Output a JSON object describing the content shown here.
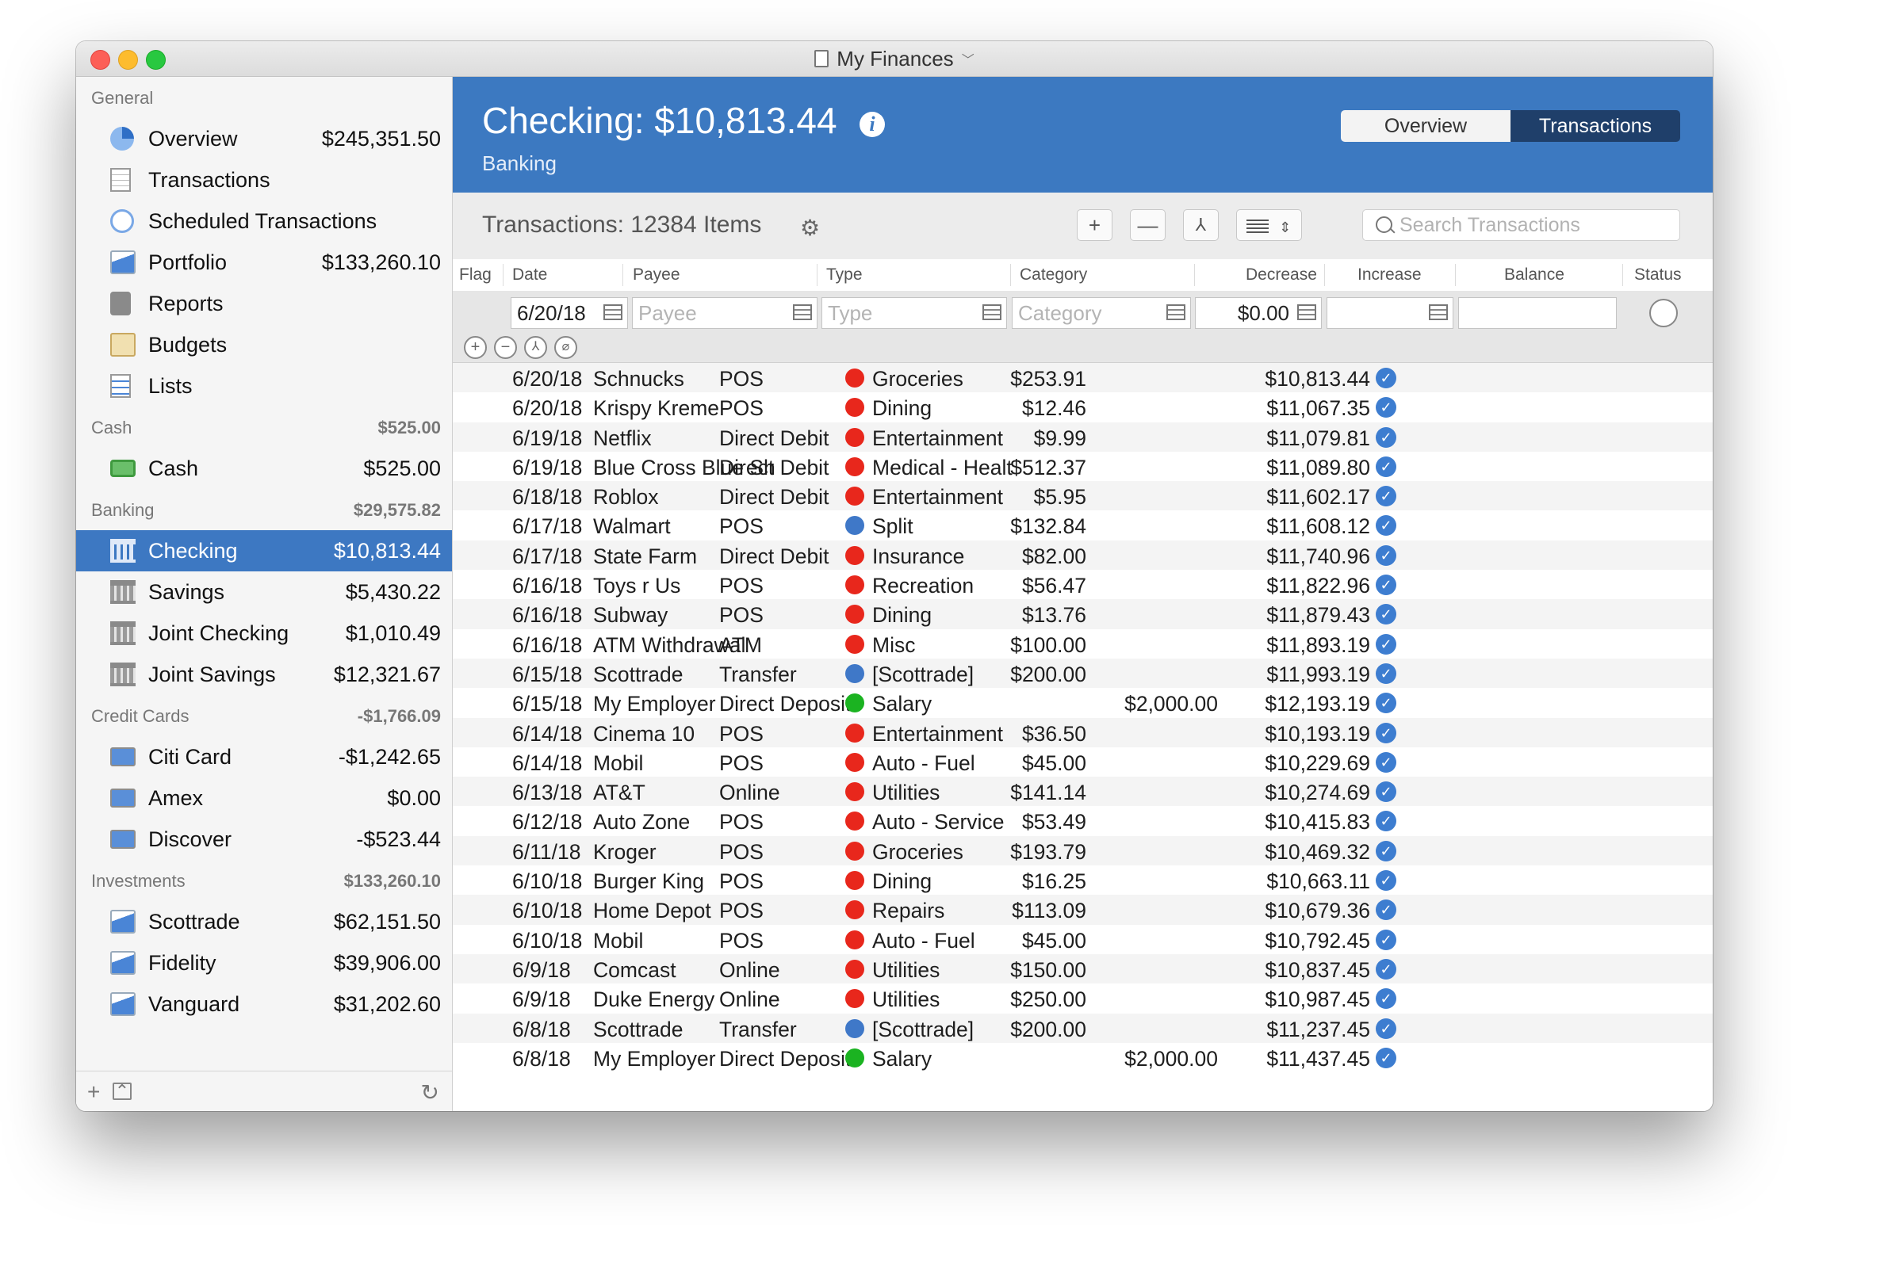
{
  "window": {
    "title": "My Finances"
  },
  "sidebar": {
    "sections": [
      {
        "name": "General",
        "total": "",
        "items": [
          {
            "label": "Overview",
            "amount": "$245,351.50",
            "icon": "pie-chart-icon"
          },
          {
            "label": "Transactions",
            "amount": "",
            "icon": "document-icon"
          },
          {
            "label": "Scheduled Transactions",
            "amount": "",
            "icon": "clock-icon"
          },
          {
            "label": "Portfolio",
            "amount": "$133,260.10",
            "icon": "line-chart-icon"
          },
          {
            "label": "Reports",
            "amount": "",
            "icon": "calculator-icon"
          },
          {
            "label": "Budgets",
            "amount": "",
            "icon": "bar-chart-icon"
          },
          {
            "label": "Lists",
            "amount": "",
            "icon": "list-icon"
          }
        ]
      },
      {
        "name": "Cash",
        "total": "$525.00",
        "items": [
          {
            "label": "Cash",
            "amount": "$525.00",
            "icon": "cash-icon"
          }
        ]
      },
      {
        "name": "Banking",
        "total": "$29,575.82",
        "items": [
          {
            "label": "Checking",
            "amount": "$10,813.44",
            "icon": "bank-icon",
            "selected": true
          },
          {
            "label": "Savings",
            "amount": "$5,430.22",
            "icon": "bank-icon"
          },
          {
            "label": "Joint Checking",
            "amount": "$1,010.49",
            "icon": "bank-icon"
          },
          {
            "label": "Joint Savings",
            "amount": "$12,321.67",
            "icon": "bank-icon"
          }
        ]
      },
      {
        "name": "Credit Cards",
        "total": "-$1,766.09",
        "items": [
          {
            "label": "Citi Card",
            "amount": "-$1,242.65",
            "icon": "credit-card-icon"
          },
          {
            "label": "Amex",
            "amount": "$0.00",
            "icon": "credit-card-icon"
          },
          {
            "label": "Discover",
            "amount": "-$523.44",
            "icon": "credit-card-icon"
          }
        ]
      },
      {
        "name": "Investments",
        "total": "$133,260.10",
        "items": [
          {
            "label": "Scottrade",
            "amount": "$62,151.50",
            "icon": "line-chart-icon"
          },
          {
            "label": "Fidelity",
            "amount": "$39,906.00",
            "icon": "line-chart-icon"
          },
          {
            "label": "Vanguard",
            "amount": "$31,202.60",
            "icon": "line-chart-icon"
          }
        ]
      }
    ],
    "footer": {
      "add": "+",
      "collapse": "⌃",
      "refresh": "↻"
    }
  },
  "header": {
    "title": "Checking: $10,813.44",
    "subtitle": "Banking",
    "tabs": [
      "Overview",
      "Transactions"
    ],
    "selected_tab": "Transactions"
  },
  "toolbar": {
    "title": "Transactions: 12384 Items",
    "add": "+",
    "remove": "—",
    "split": "⅄",
    "search_placeholder": "Search Transactions"
  },
  "columns": [
    "Flag",
    "Date",
    "Payee",
    "Type",
    "Category",
    "Decrease",
    "Increase",
    "Balance",
    "Status"
  ],
  "entry": {
    "date": "6/20/18",
    "payee_placeholder": "Payee",
    "type_placeholder": "Type",
    "category_placeholder": "Category",
    "decrease": "$0.00"
  },
  "colors": {
    "red": "#e8271c",
    "blue": "#3f78c8",
    "green": "#1bb321"
  },
  "transactions": [
    {
      "date": "6/20/18",
      "payee": "Schnucks",
      "type": "POS",
      "category": "Groceries",
      "color": "red",
      "decrease": "$253.91",
      "increase": "",
      "balance": "$10,813.44"
    },
    {
      "date": "6/20/18",
      "payee": "Krispy Kreme",
      "type": "POS",
      "category": "Dining",
      "color": "red",
      "decrease": "$12.46",
      "increase": "",
      "balance": "$11,067.35"
    },
    {
      "date": "6/19/18",
      "payee": "Netflix",
      "type": "Direct Debit",
      "category": "Entertainment",
      "color": "red",
      "decrease": "$9.99",
      "increase": "",
      "balance": "$11,079.81"
    },
    {
      "date": "6/19/18",
      "payee": "Blue Cross Blue Shi",
      "type": "Direct Debit",
      "category": "Medical - Healt",
      "color": "red",
      "decrease": "$512.37",
      "increase": "",
      "balance": "$11,089.80"
    },
    {
      "date": "6/18/18",
      "payee": "Roblox",
      "type": "Direct Debit",
      "category": "Entertainment",
      "color": "red",
      "decrease": "$5.95",
      "increase": "",
      "balance": "$11,602.17"
    },
    {
      "date": "6/17/18",
      "payee": "Walmart",
      "type": "POS",
      "category": "Split",
      "color": "blue",
      "decrease": "$132.84",
      "increase": "",
      "balance": "$11,608.12"
    },
    {
      "date": "6/17/18",
      "payee": "State Farm",
      "type": "Direct Debit",
      "category": "Insurance",
      "color": "red",
      "decrease": "$82.00",
      "increase": "",
      "balance": "$11,740.96"
    },
    {
      "date": "6/16/18",
      "payee": "Toys r Us",
      "type": "POS",
      "category": "Recreation",
      "color": "red",
      "decrease": "$56.47",
      "increase": "",
      "balance": "$11,822.96"
    },
    {
      "date": "6/16/18",
      "payee": "Subway",
      "type": "POS",
      "category": "Dining",
      "color": "red",
      "decrease": "$13.76",
      "increase": "",
      "balance": "$11,879.43"
    },
    {
      "date": "6/16/18",
      "payee": "ATM Withdrawal",
      "type": "ATM",
      "category": "Misc",
      "color": "red",
      "decrease": "$100.00",
      "increase": "",
      "balance": "$11,893.19"
    },
    {
      "date": "6/15/18",
      "payee": "Scottrade",
      "type": "Transfer",
      "category": "[Scottrade]",
      "color": "blue",
      "decrease": "$200.00",
      "increase": "",
      "balance": "$11,993.19"
    },
    {
      "date": "6/15/18",
      "payee": "My Employer",
      "type": "Direct Deposit",
      "category": "Salary",
      "color": "green",
      "decrease": "",
      "increase": "$2,000.00",
      "balance": "$12,193.19"
    },
    {
      "date": "6/14/18",
      "payee": "Cinema 10",
      "type": "POS",
      "category": "Entertainment",
      "color": "red",
      "decrease": "$36.50",
      "increase": "",
      "balance": "$10,193.19"
    },
    {
      "date": "6/14/18",
      "payee": "Mobil",
      "type": "POS",
      "category": "Auto - Fuel",
      "color": "red",
      "decrease": "$45.00",
      "increase": "",
      "balance": "$10,229.69"
    },
    {
      "date": "6/13/18",
      "payee": "AT&T",
      "type": "Online",
      "category": "Utilities",
      "color": "red",
      "decrease": "$141.14",
      "increase": "",
      "balance": "$10,274.69"
    },
    {
      "date": "6/12/18",
      "payee": "Auto Zone",
      "type": "POS",
      "category": "Auto - Service",
      "color": "red",
      "decrease": "$53.49",
      "increase": "",
      "balance": "$10,415.83"
    },
    {
      "date": "6/11/18",
      "payee": "Kroger",
      "type": "POS",
      "category": "Groceries",
      "color": "red",
      "decrease": "$193.79",
      "increase": "",
      "balance": "$10,469.32"
    },
    {
      "date": "6/10/18",
      "payee": "Burger King",
      "type": "POS",
      "category": "Dining",
      "color": "red",
      "decrease": "$16.25",
      "increase": "",
      "balance": "$10,663.11"
    },
    {
      "date": "6/10/18",
      "payee": "Home Depot",
      "type": "POS",
      "category": "Repairs",
      "color": "red",
      "decrease": "$113.09",
      "increase": "",
      "balance": "$10,679.36"
    },
    {
      "date": "6/10/18",
      "payee": "Mobil",
      "type": "POS",
      "category": "Auto - Fuel",
      "color": "red",
      "decrease": "$45.00",
      "increase": "",
      "balance": "$10,792.45"
    },
    {
      "date": "6/9/18",
      "payee": "Comcast",
      "type": "Online",
      "category": "Utilities",
      "color": "red",
      "decrease": "$150.00",
      "increase": "",
      "balance": "$10,837.45"
    },
    {
      "date": "6/9/18",
      "payee": "Duke Energy",
      "type": "Online",
      "category": "Utilities",
      "color": "red",
      "decrease": "$250.00",
      "increase": "",
      "balance": "$10,987.45"
    },
    {
      "date": "6/8/18",
      "payee": "Scottrade",
      "type": "Transfer",
      "category": "[Scottrade]",
      "color": "blue",
      "decrease": "$200.00",
      "increase": "",
      "balance": "$11,237.45"
    },
    {
      "date": "6/8/18",
      "payee": "My Employer",
      "type": "Direct Deposit",
      "category": "Salary",
      "color": "green",
      "decrease": "",
      "increase": "$2,000.00",
      "balance": "$11,437.45"
    }
  ]
}
